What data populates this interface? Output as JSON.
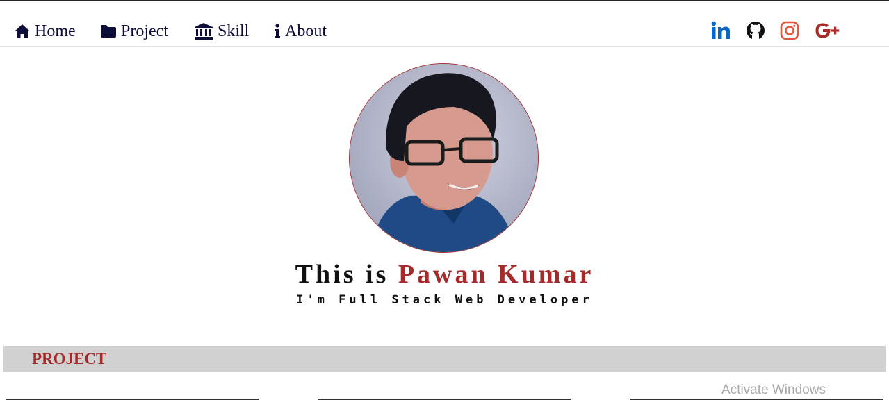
{
  "nav": {
    "items": [
      {
        "label": "Home",
        "icon": "home-icon"
      },
      {
        "label": "Project",
        "icon": "folder-icon"
      },
      {
        "label": "Skill",
        "icon": "bank-icon"
      },
      {
        "label": "About",
        "icon": "info-icon"
      }
    ],
    "social": [
      {
        "name": "linkedin-icon",
        "color": "#0a66c2"
      },
      {
        "name": "github-icon",
        "color": "#111111"
      },
      {
        "name": "instagram-icon",
        "color": "#e4573e"
      },
      {
        "name": "google-plus-icon",
        "color": "#a52a2a"
      }
    ]
  },
  "hero": {
    "prefix": "This is",
    "name": "Pawan Kumar",
    "tagline": "I'm Full Stack Web Developer"
  },
  "section": {
    "title": "PROJECT"
  },
  "system": {
    "watermark": "Activate Windows"
  },
  "colors": {
    "accent": "#a52a2a",
    "nav_text": "#0d0d3a",
    "section_bg": "#d1d1d1"
  }
}
